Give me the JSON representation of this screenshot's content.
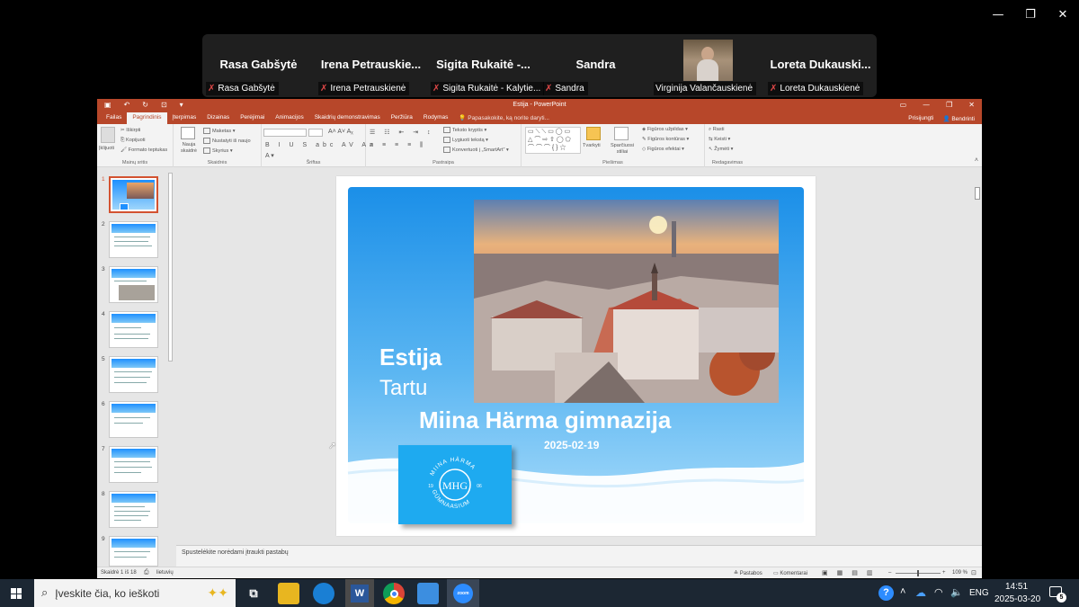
{
  "window_controls": {
    "minimize": "—",
    "restore": "❐",
    "close": "✕"
  },
  "zoom": {
    "participants": [
      {
        "display": "Rasa Gabšytė",
        "name": "Rasa Gabšytė",
        "has_video": false
      },
      {
        "display": "Irena  Petrauskie...",
        "name": "Irena Petrauskienė",
        "has_video": false
      },
      {
        "display": "Sigita  Rukaitė  -...",
        "name": "Sigita Rukaitė - Kalytie...",
        "has_video": false
      },
      {
        "display": "Sandra",
        "name": "Sandra",
        "has_video": false
      },
      {
        "display": "",
        "name": "Virginija Valančauskienė",
        "has_video": true
      },
      {
        "display": "Loreta  Dukauski...",
        "name": "Loreta Dukauskienė",
        "has_video": false
      }
    ]
  },
  "powerpoint": {
    "title": "Estija - PowerPoint",
    "tabs": [
      "Failas",
      "Pagrindinis",
      "Įterpimas",
      "Dizainas",
      "Perėjimai",
      "Animacijos",
      "Skaidrių demonstravimas",
      "Peržiūra",
      "Rodymas"
    ],
    "active_tab": "Pagrindinis",
    "tell_me": "Papasakokite, ką norite daryti...",
    "sign_in": "Prisijungti",
    "share": "Bendrinti",
    "ribbon": {
      "clipboard": {
        "paste": "Įklijuoti",
        "cut": "Iškirpti",
        "copy": "Kopijuoti",
        "format_painter": "Formato teptukas",
        "label": "Mainų sritis"
      },
      "slides": {
        "new_slide": "Nauja skaidrė",
        "layout": "Maketas",
        "reset": "Nustatyti iš naujo",
        "section": "Skyrius",
        "label": "Skaidrės"
      },
      "font": {
        "label": "Šriftas"
      },
      "paragraph": {
        "text_direction": "Teksto kryptis",
        "align_text": "Lygiuoti tekstą",
        "convert": "Konvertuoti į „SmartArt“",
        "label": "Pastraipa"
      },
      "drawing": {
        "arrange": "Tvarkyti",
        "quick_styles": "Sparčiuosi stiliai",
        "fill": "Figūros užpildas",
        "outline": "Figūros kontūras",
        "effects": "Figūros efektai",
        "label": "Piešimas"
      },
      "editing": {
        "find": "Rasti",
        "replace": "Keisti",
        "select": "Žymėti",
        "label": "Redagavimas"
      }
    },
    "thumbnails": [
      "1",
      "2",
      "3",
      "4",
      "5",
      "6",
      "7",
      "8",
      "9"
    ],
    "active_slide": "1",
    "slide": {
      "country": "Estija",
      "city": "Tartu",
      "school": "Miina Härma gimnazija",
      "date": "2025-02-19",
      "logo_text": "MIINA HÄRMA GÜMNAASIUM",
      "logo_numbers": "19 06",
      "logo_letters": "MHG"
    },
    "notes_placeholder": "Spustelėkite norėdami įtraukti pastabų",
    "status": {
      "slide_count": "Skaidrė 1 iš 18",
      "language": "lietuvių",
      "notes": "Pastabos",
      "comments": "Komentarai",
      "zoom": "109 %"
    }
  },
  "taskbar": {
    "search_placeholder": "Įveskite čia, ko ieškoti",
    "lang": "ENG",
    "time": "14:51",
    "date": "2025-03-20",
    "notifications": "5",
    "zoom_label": "zoom"
  },
  "colors": {
    "ppt_red": "#b7472a",
    "slide_blue": "#1e90ff",
    "taskbar": "#1c2733",
    "zoom_strip": "#1f1f1f"
  }
}
